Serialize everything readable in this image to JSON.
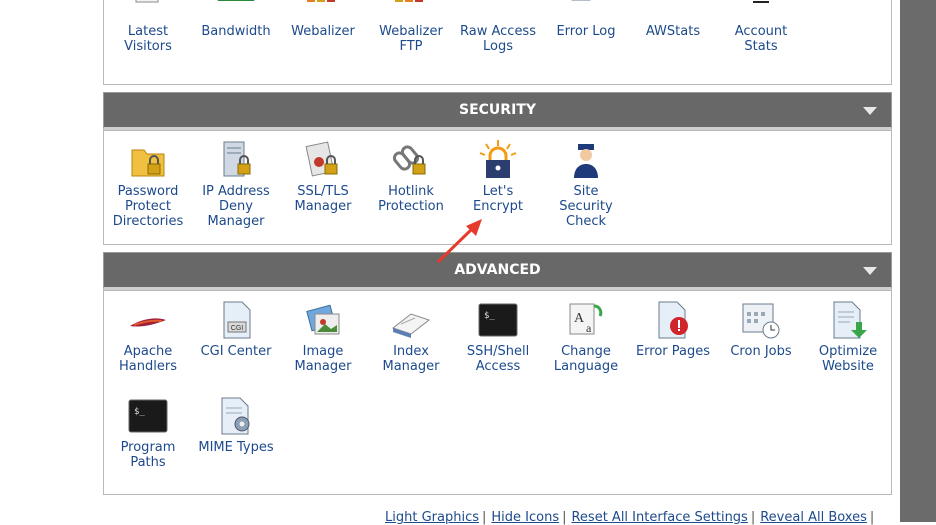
{
  "stats_items": [
    {
      "label": "Latest\nVisitors",
      "icon": "latest-visitors-icon"
    },
    {
      "label": "Bandwidth",
      "icon": "bandwidth-icon"
    },
    {
      "label": "Webalizer",
      "icon": "webalizer-icon"
    },
    {
      "label": "Webalizer\nFTP",
      "icon": "webalizer-ftp-icon"
    },
    {
      "label": "Raw Access\nLogs",
      "icon": "raw-access-logs-icon"
    },
    {
      "label": "Error Log",
      "icon": "error-log-icon"
    },
    {
      "label": "AWStats",
      "icon": "awstats-icon"
    },
    {
      "label": "Account\nStats",
      "icon": "account-stats-icon"
    }
  ],
  "security": {
    "title": "SECURITY",
    "items": [
      {
        "label": "Password\nProtect\nDirectories",
        "icon": "folder-lock-icon"
      },
      {
        "label": "IP Address\nDeny\nManager",
        "icon": "server-lock-icon"
      },
      {
        "label": "SSL/TLS\nManager",
        "icon": "ssl-certificate-icon"
      },
      {
        "label": "Hotlink\nProtection",
        "icon": "chain-lock-icon"
      },
      {
        "label": "Let's\nEncrypt",
        "icon": "lets-encrypt-icon"
      },
      {
        "label": "Site\nSecurity\nCheck",
        "icon": "security-guard-icon"
      }
    ]
  },
  "advanced": {
    "title": "ADVANCED",
    "items": [
      {
        "label": "Apache\nHandlers",
        "icon": "apache-feather-icon"
      },
      {
        "label": "CGI Center",
        "icon": "cgi-document-icon"
      },
      {
        "label": "Image\nManager",
        "icon": "image-manager-icon"
      },
      {
        "label": "Index\nManager",
        "icon": "index-book-icon"
      },
      {
        "label": "SSH/Shell\nAccess",
        "icon": "terminal-icon"
      },
      {
        "label": "Change\nLanguage",
        "icon": "language-icon"
      },
      {
        "label": "Error Pages",
        "icon": "error-page-icon"
      },
      {
        "label": "Cron Jobs",
        "icon": "calendar-clock-icon"
      },
      {
        "label": "Optimize\nWebsite",
        "icon": "optimize-document-icon"
      },
      {
        "label": "Program\nPaths",
        "icon": "program-terminal-icon"
      },
      {
        "label": "MIME Types",
        "icon": "mime-document-icon"
      }
    ]
  },
  "footer": {
    "links": [
      "Light Graphics",
      "Hide Icons",
      "Reset All Interface Settings",
      "Reveal All Boxes"
    ],
    "separator": "|"
  },
  "colors": {
    "header_bg": "#686868",
    "link": "#1d4a8c",
    "annotation_arrow": "#e53b2c"
  }
}
